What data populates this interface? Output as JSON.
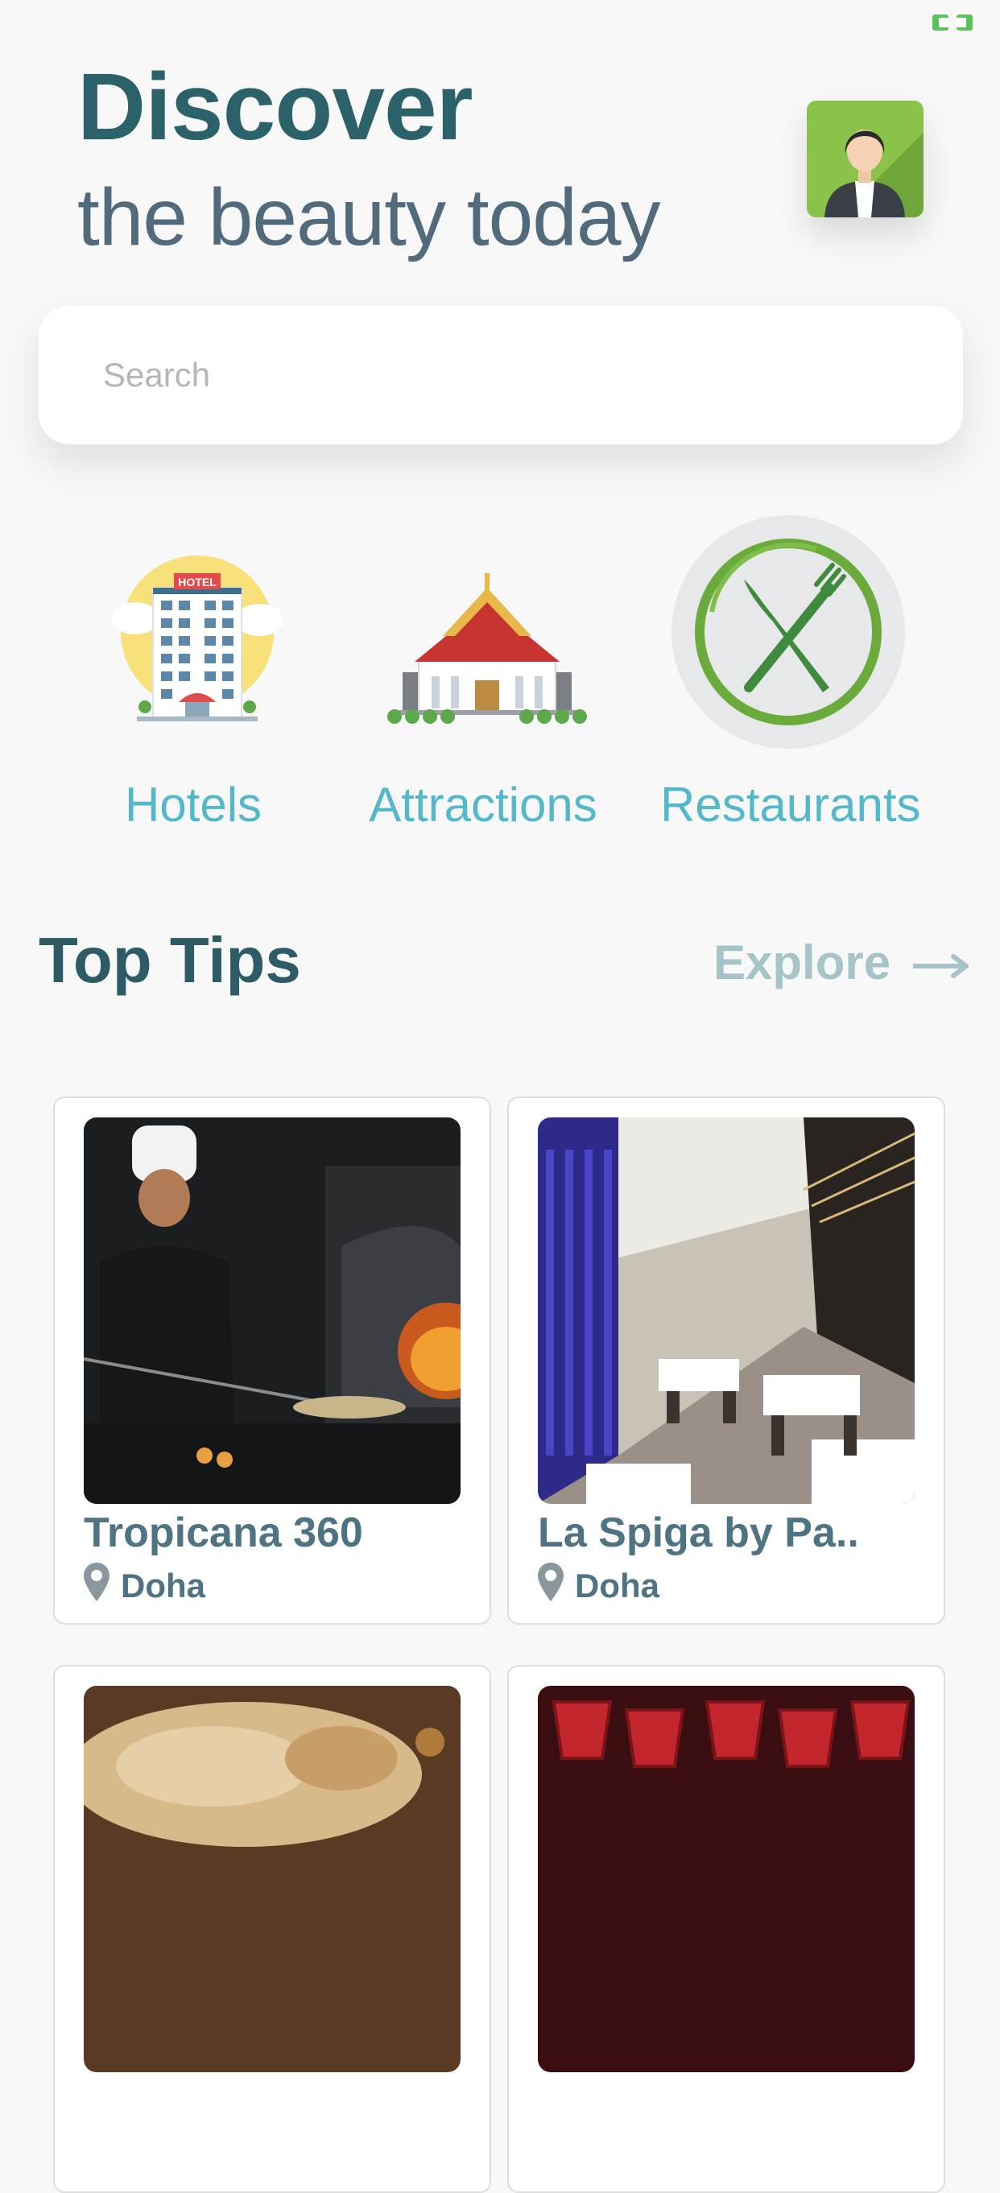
{
  "header": {
    "title_strong": "Discover",
    "title_light": "the beauty today"
  },
  "search": {
    "placeholder": "Search"
  },
  "categories": [
    {
      "label": "Hotels",
      "icon": "hotel-icon"
    },
    {
      "label": "Attractions",
      "icon": "temple-icon"
    },
    {
      "label": "Restaurants",
      "icon": "fork-knife-icon",
      "selected": true
    }
  ],
  "top_tips": {
    "title": "Top Tips",
    "explore_label": "Explore",
    "cards": [
      {
        "name": "Tropicana 360",
        "location": "Doha"
      },
      {
        "name": "La Spiga by Pa..",
        "location": "Doha"
      },
      {
        "name": "",
        "location": ""
      },
      {
        "name": "",
        "location": ""
      }
    ]
  },
  "colors": {
    "title": "#2b6168",
    "subtitle": "#526b7c",
    "accent": "#53b8c9",
    "explore": "#a6c4c7",
    "card_text": "#4e7382"
  }
}
